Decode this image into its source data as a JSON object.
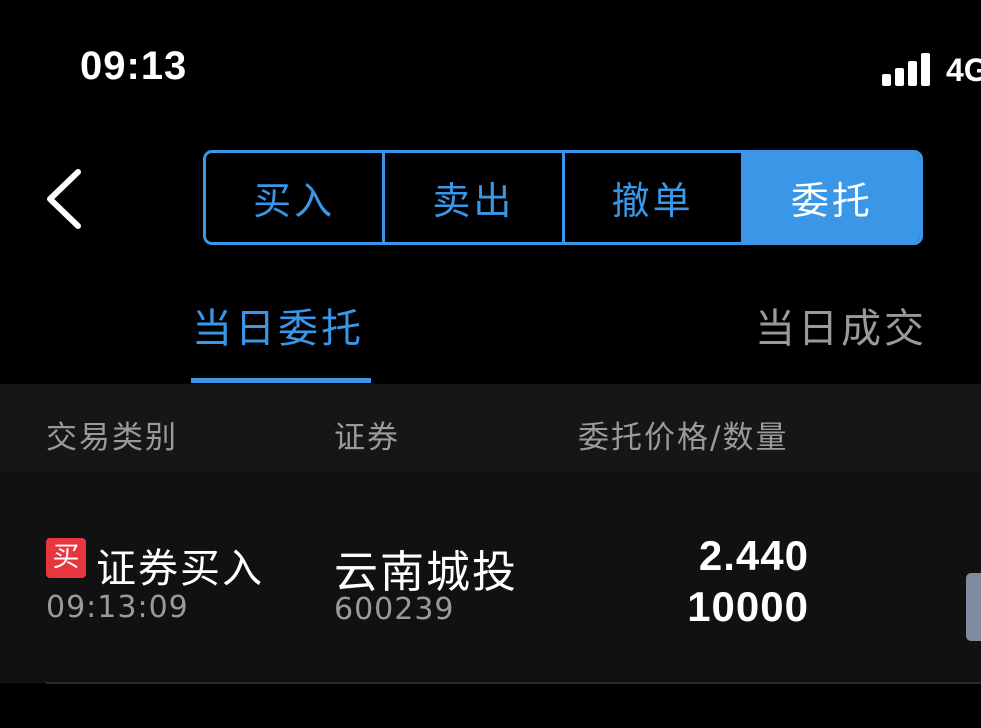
{
  "status_bar": {
    "time": "09:13",
    "network": "4G"
  },
  "nav": {
    "back_icon": "chevron-left-icon"
  },
  "segmented_tabs": [
    {
      "label": "买入",
      "active": false
    },
    {
      "label": "卖出",
      "active": false
    },
    {
      "label": "撤单",
      "active": false
    },
    {
      "label": "委托",
      "active": true
    }
  ],
  "sub_tabs": [
    {
      "label": "当日委托",
      "active": true
    },
    {
      "label": "当日成交",
      "active": false
    }
  ],
  "table": {
    "headers": [
      "交易类别",
      "证券",
      "委托价格/数量"
    ],
    "rows": [
      {
        "badge": "买",
        "trade_type": "证券买入",
        "time": "09:13:09",
        "security_name": "云南城投",
        "security_code": "600239",
        "price": "2.440",
        "quantity": "10000"
      }
    ]
  },
  "colors": {
    "accent": "#3a96e6",
    "buy_badge": "#e8363f",
    "muted_text": "#9a9a9a",
    "background": "#000000"
  }
}
